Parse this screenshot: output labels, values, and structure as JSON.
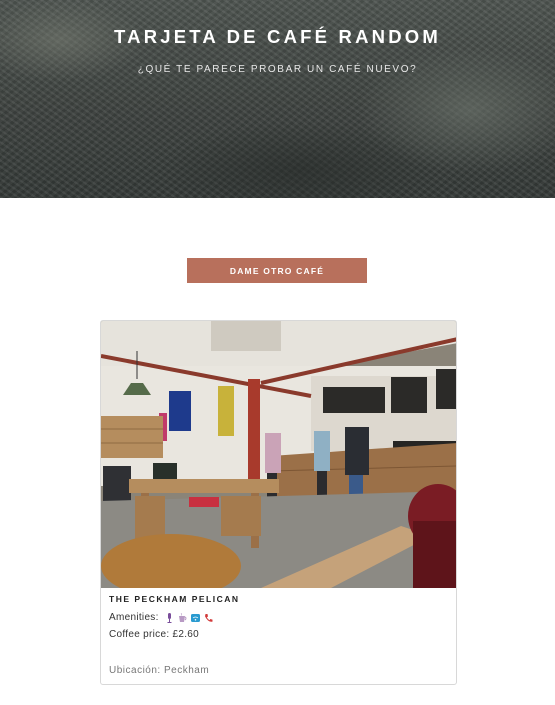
{
  "hero": {
    "title": "TARJETA DE CAFÉ RANDOM",
    "subtitle": "¿QUÉ TE PARECE PROBAR UN CAFÉ NUEVO?"
  },
  "action": {
    "label": "DAME OTRO CAFÉ"
  },
  "card": {
    "name": "THE PECKHAM PELICAN",
    "amenities_label": "Amenities:",
    "amenity_icons": [
      "microphone-icon",
      "coffee-cup-icon",
      "wifi-icon",
      "phone-icon"
    ],
    "price": "Coffee price: £2.60",
    "location": "Ubicación: Peckham"
  },
  "colors": {
    "button": "#b8705c",
    "hero_bg": "#3d423f",
    "amenity_mic": "#7a4e9b",
    "amenity_cup": "#b89ac4",
    "amenity_wifi": "#2a9bd0",
    "amenity_phone": "#d23a3a"
  }
}
